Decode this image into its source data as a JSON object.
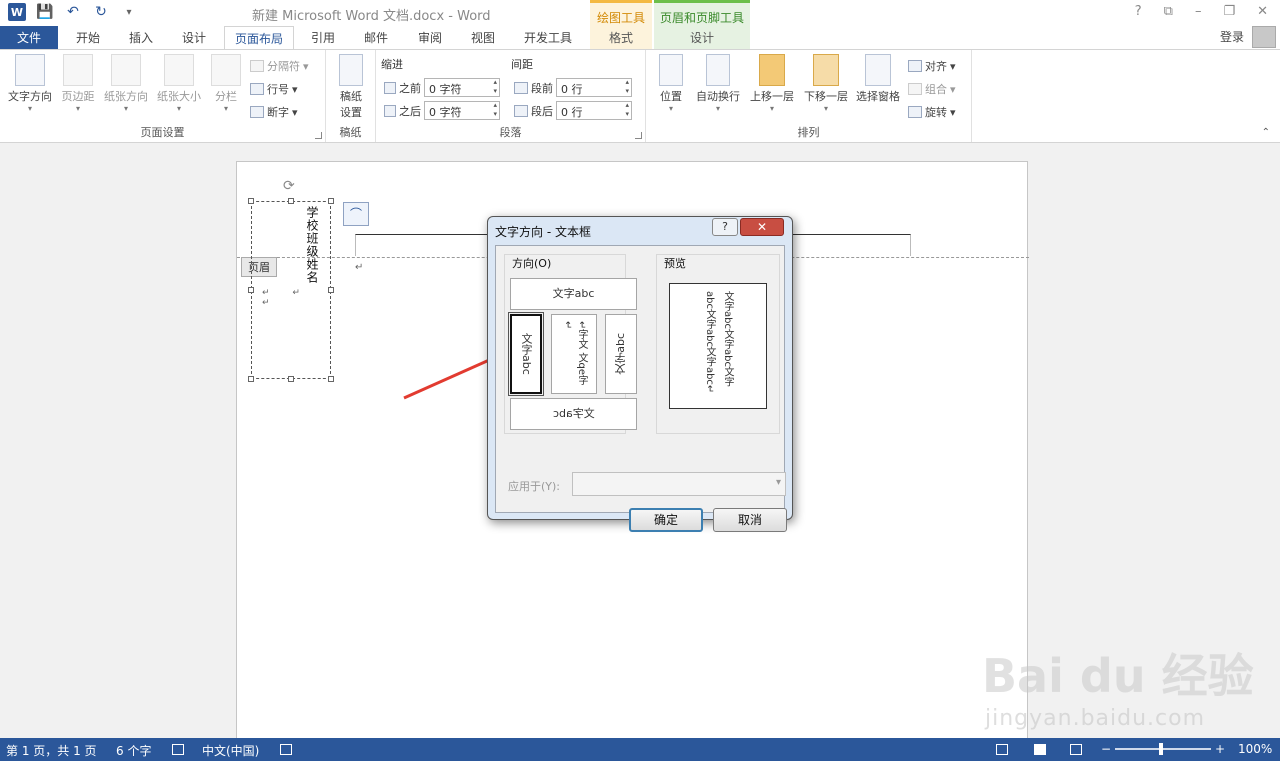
{
  "titlebar": {
    "title": "新建 Microsoft Word 文档.docx - Word",
    "app_icon_letter": "W",
    "ctx_draw_header": "绘图工具",
    "ctx_hf_header": "页眉和页脚工具",
    "help": "?",
    "restore_ribbon": "⧉",
    "minimize": "–",
    "maximize": "❐",
    "close": "✕",
    "qat_customize": "▾"
  },
  "tabs": {
    "file": "文件",
    "home": "开始",
    "insert": "插入",
    "design": "设计",
    "layout": "页面布局",
    "references": "引用",
    "mailings": "邮件",
    "review": "审阅",
    "view": "视图",
    "developer": "开发工具",
    "format": "格式",
    "hf_design": "设计",
    "login": "登录"
  },
  "ribbon": {
    "page_setup": {
      "label": "页面设置",
      "text_direction": "文字方向",
      "margins": "页边距",
      "orientation": "纸张方向",
      "size": "纸张大小",
      "columns": "分栏",
      "breaks": "分隔符",
      "line_numbers": "行号",
      "hyphenation": "断字"
    },
    "manuscript": {
      "label": "稿纸",
      "settings_line1": "稿纸",
      "settings_line2": "设置"
    },
    "paragraph": {
      "label": "段落",
      "indent": "缩进",
      "spacing": "间距",
      "before_label": "之前",
      "after_label": "之后",
      "indent_before": "0 字符",
      "indent_after": "0 字符",
      "space_before_label": "段前",
      "space_after_label": "段后",
      "space_before": "0 行",
      "space_after": "0 行"
    },
    "arrange": {
      "label": "排列",
      "position": "位置",
      "wrap": "自动换行",
      "bring_forward": "上移一层",
      "send_backward": "下移一层",
      "selection_pane": "选择窗格",
      "align": "对齐",
      "group": "组合",
      "rotate": "旋转"
    }
  },
  "document": {
    "header_tag": "页眉",
    "textbox_text": "学校班级姓名",
    "textbox_marks": "↵ ↵ ↵",
    "para_mark": "↵",
    "layout_icon": "⌒"
  },
  "dialog": {
    "title": "文字方向 - 文本框",
    "help": "?",
    "close": "✕",
    "orientation_legend": "方向(O)",
    "preview_legend": "预览",
    "opt_horizontal": "文字abc",
    "opt_vertical": "文字abc",
    "opt_vertical_stacked": "↵字文 文qe字↵",
    "opt_rotated": "文字abc",
    "opt_horizontal_flipped": "文字abc",
    "preview_text": "文字abc文字abc文字abc文字abc文字abc↵",
    "apply_label": "应用于(Y):",
    "ok": "确定",
    "cancel": "取消"
  },
  "statusbar": {
    "page": "第 1 页，共 1 页",
    "words": "6 个字",
    "language": "中文(中国)",
    "zoom_minus": "−",
    "zoom_plus": "+",
    "zoom": "100%"
  },
  "watermark": {
    "brand": "Bai du 经验",
    "url": "jingyan.baidu.com"
  }
}
